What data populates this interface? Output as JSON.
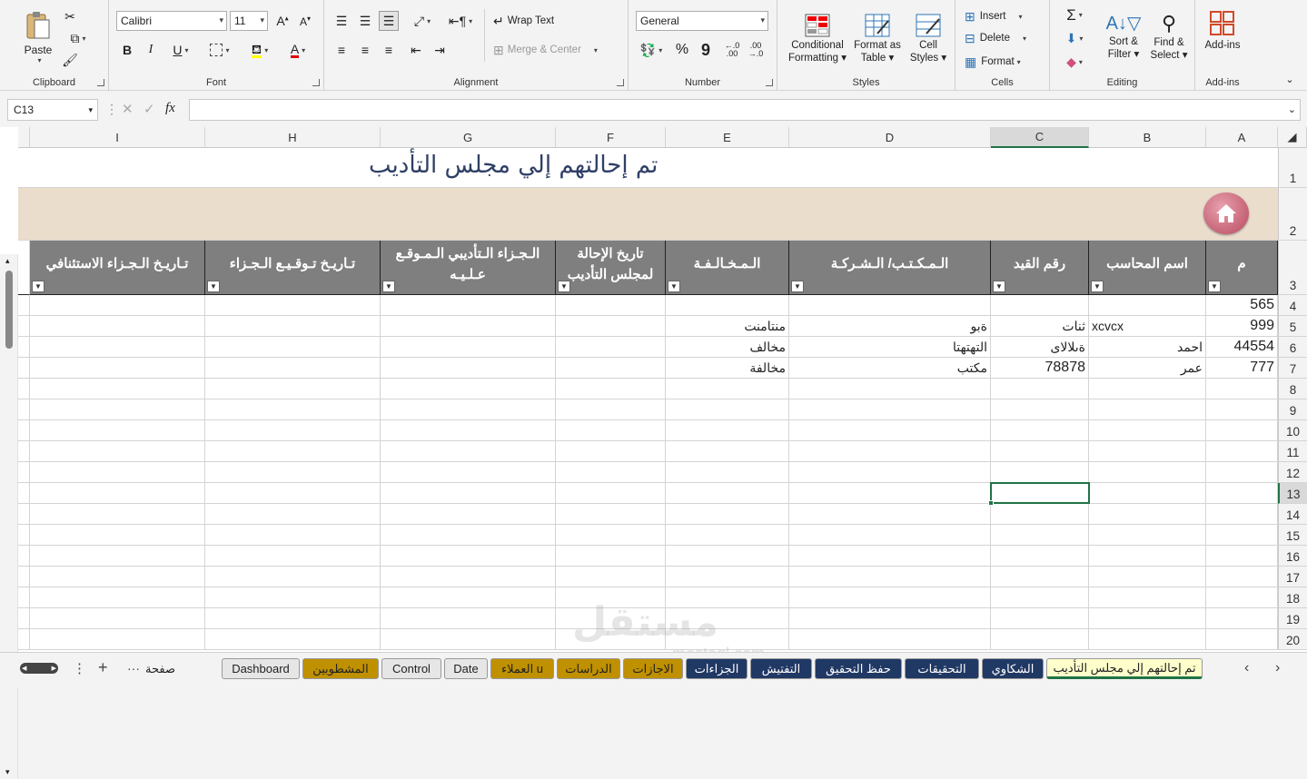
{
  "ribbon": {
    "clipboard": {
      "label": "Clipboard",
      "paste": "Paste"
    },
    "font": {
      "label": "Font",
      "name": "Calibri",
      "size": "11"
    },
    "alignment": {
      "label": "Alignment",
      "wrap": "Wrap Text",
      "merge": "Merge & Center"
    },
    "number": {
      "label": "Number",
      "format": "General"
    },
    "styles": {
      "label": "Styles",
      "conditional": "Conditional",
      "conditional2": "Formatting",
      "format_table": "Format as",
      "format_table2": "Table",
      "cell_styles": "Cell",
      "cell_styles2": "Styles"
    },
    "cells": {
      "label": "Cells",
      "insert": "Insert",
      "delete": "Delete",
      "format": "Format"
    },
    "editing": {
      "label": "Editing",
      "sort": "Sort &",
      "sort2": "Filter",
      "find": "Find &",
      "find2": "Select"
    },
    "addins": {
      "label": "Add-ins",
      "btn": "Add-ins"
    }
  },
  "formula_bar": {
    "name_box": "C13",
    "fx": "fx",
    "value": ""
  },
  "columns": [
    {
      "letter": "A"
    },
    {
      "letter": "B"
    },
    {
      "letter": "C"
    },
    {
      "letter": "D"
    },
    {
      "letter": "E"
    },
    {
      "letter": "F"
    },
    {
      "letter": "G"
    },
    {
      "letter": "H"
    },
    {
      "letter": "I"
    }
  ],
  "rows": [
    "1",
    "2",
    "3",
    "4",
    "5",
    "6",
    "7",
    "8",
    "9",
    "10",
    "11",
    "12",
    "13",
    "14",
    "15",
    "16",
    "17",
    "18",
    "19",
    "20"
  ],
  "sheet": {
    "title": "تم إحالتهم إلي مجلس التأديب",
    "headers": [
      {
        "col": "A",
        "text": "م"
      },
      {
        "col": "B",
        "text": "اسم المحاسب"
      },
      {
        "col": "C",
        "text": "رقم القيد"
      },
      {
        "col": "D",
        "text": "الـمـكـتـب/ الـشـركـة"
      },
      {
        "col": "E",
        "text": "الـمـخـالـفـة"
      },
      {
        "col": "F",
        "text": "تاريخ الإحالة لمجلس التأديب"
      },
      {
        "col": "G",
        "text": "الـجـزاء الـتأديبي الـمـوقـع عـلـيـه"
      },
      {
        "col": "H",
        "text": "تـاريـخ تـوقـيـع الـجـزاء"
      },
      {
        "col": "I",
        "text": "تـاريـخ الـجـزاء الاستئنافي"
      }
    ],
    "data": [
      {
        "A": "565",
        "B": "",
        "C": "",
        "D": "",
        "E": ""
      },
      {
        "A": "999",
        "B": "xcvcx",
        "C": "ثنات",
        "D": "ةبو",
        "E": "منتامنت"
      },
      {
        "A": "44554",
        "B": "احمد",
        "C": "ةىلالاى",
        "D": "التهتهتا",
        "E": "مخالف"
      },
      {
        "A": "777",
        "B": "عمر",
        "C": "78878",
        "D": "مكتب",
        "E": "مخالفة"
      }
    ]
  },
  "tabs": [
    {
      "label": "تم إحالتهم إلي مجلس التأديب",
      "bg": "#ffffcc",
      "fg": "#222222",
      "active": true
    },
    {
      "label": "الشكاوي",
      "bg": "#203864",
      "fg": "#ffffff"
    },
    {
      "label": "التحقيقات",
      "bg": "#203864",
      "fg": "#ffffff"
    },
    {
      "label": "حفظ التحقيق",
      "bg": "#203864",
      "fg": "#ffffff"
    },
    {
      "label": "التفتيش",
      "bg": "#203864",
      "fg": "#ffffff"
    },
    {
      "label": "الجزاءات",
      "bg": "#203864",
      "fg": "#ffffff"
    },
    {
      "label": "الاجازات",
      "bg": "#bf9000",
      "fg": "#222222"
    },
    {
      "label": "الدراسات",
      "bg": "#bf9000",
      "fg": "#222222"
    },
    {
      "label": "العملاء u",
      "bg": "#bf9000",
      "fg": "#222222"
    },
    {
      "label": "Date",
      "bg": "#e7e6e6",
      "fg": "#222222"
    },
    {
      "label": "Control",
      "bg": "#e7e6e6",
      "fg": "#222222"
    },
    {
      "label": "المشطوبين",
      "bg": "#bf9000",
      "fg": "#222222"
    },
    {
      "label": "Dashboard",
      "bg": "#e7e6e6",
      "fg": "#222222"
    }
  ],
  "tab_extra": {
    "more": "صفحة",
    "ellipsis": "···",
    "add": "+",
    "dots": "⋮"
  },
  "watermark": {
    "text": "مستقل",
    "sub": "mostaql.com"
  }
}
